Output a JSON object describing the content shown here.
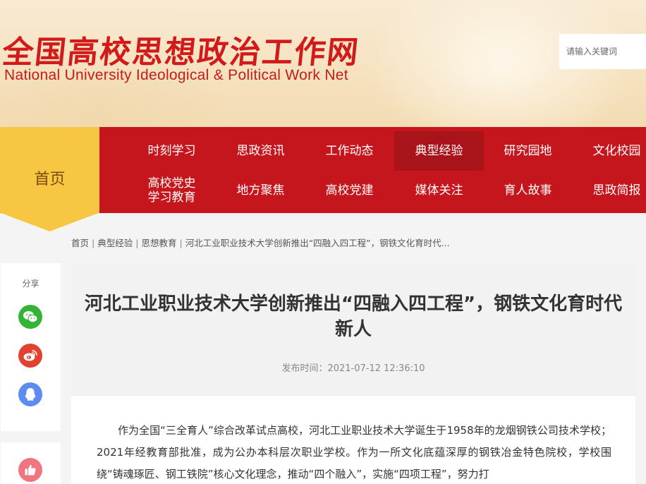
{
  "header": {
    "logo_cn": "全国高校思想政治工作网",
    "logo_en": "National University Ideological & Political Work Net",
    "search_placeholder": "请输入关键词"
  },
  "nav": {
    "home": "首页",
    "active_item": "典型经验",
    "row1": [
      "时刻学习",
      "思政资讯",
      "工作动态",
      "典型经验",
      "研究园地",
      "文化校园"
    ],
    "row2": [
      "高校党史\n学习教育",
      "地方聚焦",
      "高校党建",
      "媒体关注",
      "育人故事",
      "思政简报"
    ]
  },
  "breadcrumb": {
    "items": [
      "首页",
      "典型经验",
      "思想教育",
      "河北工业职业技术大学创新推出“四融入四工程”，钢铁文化育时代..."
    ]
  },
  "share": {
    "label": "分享",
    "icons": [
      "wechat-icon",
      "weibo-icon",
      "qq-icon"
    ]
  },
  "like": {
    "icon": "thumbs-up-icon"
  },
  "article": {
    "title": "河北工业职业技术大学创新推出“四融入四工程”，钢铁文化育时代新人",
    "meta": "发布时间：2021-07-12 12:36:10",
    "body": "作为全国“三全育人”综合改革试点高校，河北工业职业技术大学诞生于1958年的龙烟钢铁公司技术学校；2021年经教育部批准，成为公办本科层次职业学校。作为一所文化底蕴深厚的钢铁冶金特色院校，学校围绕“铸魂琢匠、钢工铁院”核心文化理念，推动“四个融入”，实施“四项工程”，努力打"
  },
  "colors": {
    "nav_red": "#c4161c",
    "nav_active": "#a8141a",
    "home_yellow": "#f7c744",
    "logo_red": "#d11a1a"
  }
}
